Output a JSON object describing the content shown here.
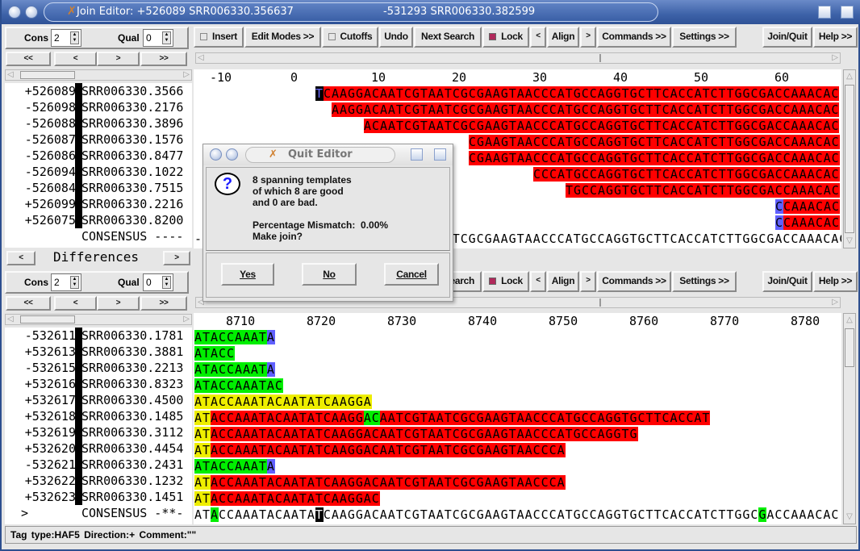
{
  "window": {
    "title": "Join Editor: +526089 SRR006330.356637",
    "title_right": "-531293 SRR006330.382599"
  },
  "toolbar": {
    "cons_label": "Cons",
    "cons_value": "2",
    "qual_label": "Qual",
    "qual_value": "0",
    "insert_label": "Insert",
    "edit_modes_label": "Edit Modes >>",
    "cutoffs_label": "Cutoffs",
    "undo_label": "Undo",
    "next_search_label": "Next Search",
    "lock_label": "Lock",
    "prev_label": "<",
    "align_label": "Align",
    "next_label": ">",
    "commands_label": "Commands >>",
    "settings_label": "Settings >>",
    "join_quit_label": "Join/Quit",
    "help_label": "Help >>",
    "lock_checked": true,
    "insert_checked": false,
    "cutoffs_checked": false
  },
  "nav": {
    "first": "<<",
    "prev": "<",
    "next": ">",
    "last": ">>"
  },
  "differences": {
    "prev": "<",
    "label": "Differences",
    "next": ">"
  },
  "top_contig": {
    "ruler": [
      "-10",
      "0",
      "10",
      "20",
      "30",
      "40",
      "50",
      "60"
    ],
    "reads": [
      {
        "num": "+526089",
        "name": "SRR006330.3566"
      },
      {
        "num": "-526098",
        "name": "SRR006330.2176"
      },
      {
        "num": "-526088",
        "name": "SRR006330.3896"
      },
      {
        "num": "-526087",
        "name": "SRR006330.1576"
      },
      {
        "num": "-526086",
        "name": "SRR006330.8477"
      },
      {
        "num": "-526094",
        "name": "SRR006330.1022"
      },
      {
        "num": "-526084",
        "name": "SRR006330.7515"
      },
      {
        "num": "+526099",
        "name": "SRR006330.2216"
      },
      {
        "num": "+526075",
        "name": "SRR006330.8200"
      }
    ],
    "consensus_label": "CONSENSUS ----",
    "sequences": [
      {
        "offset": 15,
        "segments": [
          {
            "t": "T",
            "c": "k"
          },
          {
            "t": "CAAGGACAATCGTAATCGCGAAGTAACCCATGCCAGGTGCTTCACCATCTTGGCGACCAAACAC",
            "c": "r"
          }
        ]
      },
      {
        "offset": 17,
        "segments": [
          {
            "t": "AAGGACAATCGTAATCGCGAAGTAACCCATGCCAGGTGCTTCACCATCTTGGCGACCAAACAC",
            "c": "r"
          }
        ]
      },
      {
        "offset": 21,
        "segments": [
          {
            "t": "ACAATCGTAATCGCGAAGTAACCCATGCCAGGTGCTTCACCATCTTGGCGACCAAACAC",
            "c": "r"
          }
        ]
      },
      {
        "offset": 34,
        "segments": [
          {
            "t": "CGAAGTAACCCATGCCAGGTGCTTCACCATCTTGGCGACCAAACAC",
            "c": "r"
          }
        ]
      },
      {
        "offset": 34,
        "segments": [
          {
            "t": "CGAAGTAACCCATGCCAGGTGCTTCACCATCTTGGCGACCAAACAC",
            "c": "r"
          }
        ]
      },
      {
        "offset": 42,
        "segments": [
          {
            "t": "CCCATGCCAGGTGCTTCACCATCTTGGCGACCAAACAC",
            "c": "r"
          }
        ]
      },
      {
        "offset": 46,
        "segments": [
          {
            "t": "TGCCAGGTGCTTCACCATCTTGGCGACCAAACAC",
            "c": "r"
          }
        ]
      },
      {
        "offset": 72,
        "segments": [
          {
            "t": "C",
            "c": "b"
          },
          {
            "t": "CAAACAC",
            "c": "r"
          }
        ]
      },
      {
        "offset": 72,
        "segments": [
          {
            "t": "C",
            "c": "b"
          },
          {
            "t": "CAAACAC",
            "c": "r"
          }
        ]
      }
    ],
    "consensus": "-----------------CAAGGACAATCGTAATCGCGAAGTAACCCATGCCAGGTGCTTCACCATCTTGGCGACCAAACAC"
  },
  "bottom_contig": {
    "ruler": [
      "8710",
      "8720",
      "8730",
      "8740",
      "8750",
      "8760",
      "8770",
      "8780"
    ],
    "reads": [
      {
        "num": "-532611",
        "name": "SRR006330.1781"
      },
      {
        "num": "+532613",
        "name": "SRR006330.3881"
      },
      {
        "num": "-532615",
        "name": "SRR006330.2213"
      },
      {
        "num": "+532616",
        "name": "SRR006330.8323"
      },
      {
        "num": "+532617",
        "name": "SRR006330.4500"
      },
      {
        "num": "+532618",
        "name": "SRR006330.1485"
      },
      {
        "num": "+532619",
        "name": "SRR006330.3112"
      },
      {
        "num": "+532620",
        "name": "SRR006330.4454"
      },
      {
        "num": "-532621",
        "name": "SRR006330.2431"
      },
      {
        "num": "+532622",
        "name": "SRR006330.1232"
      },
      {
        "num": "+532623",
        "name": "SRR006330.1451"
      }
    ],
    "consensus_marker": ">",
    "consensus_label": "CONSENSUS -**-",
    "sequences": [
      {
        "offset": 0,
        "segments": [
          {
            "t": "ATACCAAAT",
            "c": "g"
          },
          {
            "t": "A",
            "c": "b"
          }
        ]
      },
      {
        "offset": 0,
        "segments": [
          {
            "t": "ATACC",
            "c": "g"
          }
        ]
      },
      {
        "offset": 0,
        "segments": [
          {
            "t": "ATACCAAAT",
            "c": "g"
          },
          {
            "t": "A",
            "c": "b"
          }
        ]
      },
      {
        "offset": 0,
        "segments": [
          {
            "t": "ATACCAAATAC",
            "c": "g"
          }
        ]
      },
      {
        "offset": 0,
        "segments": [
          {
            "t": "ATACCAAATACAATATCAAGGA",
            "c": "y"
          }
        ]
      },
      {
        "offset": 0,
        "segments": [
          {
            "t": "AT",
            "c": "y"
          },
          {
            "t": "ACCAAATACAATATCAAGG",
            "c": "r"
          },
          {
            "t": "AC",
            "c": "g"
          },
          {
            "t": "AATCGTAATCGCGAAGTAACCCATGCCAGGTGCTTCACCAT",
            "c": "r"
          }
        ]
      },
      {
        "offset": 0,
        "segments": [
          {
            "t": "AT",
            "c": "y"
          },
          {
            "t": "ACCAAATACAATATCAAGGACAATCGTAATCGCGAAGTAACCCATGCCAGGTG",
            "c": "r"
          }
        ]
      },
      {
        "offset": 0,
        "segments": [
          {
            "t": "AT",
            "c": "y"
          },
          {
            "t": "ACCAAATACAATATCAAGGACAATCGTAATCGCGAAGTAACCCA",
            "c": "r"
          }
        ]
      },
      {
        "offset": 0,
        "segments": [
          {
            "t": "ATACCAAAT",
            "c": "g"
          },
          {
            "t": "A",
            "c": "b"
          }
        ]
      },
      {
        "offset": 0,
        "segments": [
          {
            "t": "AT",
            "c": "y"
          },
          {
            "t": "ACCAAATACAATATCAAGGACAATCGTAATCGCGAAGTAACCCA",
            "c": "r"
          }
        ]
      },
      {
        "offset": 0,
        "segments": [
          {
            "t": "AT",
            "c": "y"
          },
          {
            "t": "ACCAAATACAATATCAAGGAC",
            "c": "r"
          }
        ]
      }
    ],
    "consensus_segments": [
      {
        "t": "AT",
        "c": ""
      },
      {
        "t": "A",
        "c": "g"
      },
      {
        "t": "CCAAATACAATA",
        "c": ""
      },
      {
        "t": "T",
        "c": "kw"
      },
      {
        "t": "CAAGGACAATCGTAATCGCGAAGTAACCCATGCCAGGTGCTTCACCATCTTGGC",
        "c": ""
      },
      {
        "t": "G",
        "c": "g"
      },
      {
        "t": "ACCAAACAC",
        "c": ""
      }
    ]
  },
  "status_bar": {
    "text": "Tag type:HAF5   Direction:+   Comment:\"\""
  },
  "dialog": {
    "title": "Quit Editor",
    "icon": "question-icon",
    "lines": [
      "8 spanning templates",
      "of which 8 are good",
      "and 0 are bad.",
      "",
      "Percentage Mismatch:  0.00%",
      "Make join?"
    ],
    "yes_label": "Yes",
    "no_label": "No",
    "cancel_label": "Cancel"
  },
  "colors": {
    "red": "#ff0000",
    "green": "#00ee00",
    "yellow": "#eeee00",
    "blue": "#6060ff",
    "title_bar": "#3d62a8"
  }
}
